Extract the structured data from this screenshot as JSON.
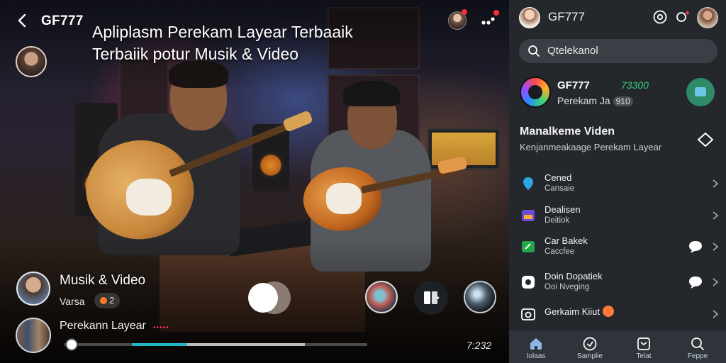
{
  "header": {
    "brand": "GF777",
    "headline_line1": "Apliplasm Perekam Layear Terbaaik",
    "headline_line2": "Terbaiik potur Musik & Video"
  },
  "author": {
    "name": "Musik & Video",
    "sub": "Varsa",
    "pill": "2"
  },
  "now_playing": {
    "title": "Perekann Layear",
    "indicator": "•••••"
  },
  "player": {
    "time": "7:232",
    "progress": 0.4
  },
  "panel": {
    "brand": "GF777",
    "search_placeholder": "Qtelekanol",
    "featured": {
      "title": "GF777",
      "price": "73300",
      "sub": "Perekam Ja",
      "chip": "910"
    },
    "section": {
      "title": "Manalkeme Viden",
      "sub": "Kenjanmeakaage Perekam Layear"
    },
    "menu": [
      {
        "title": "Cened",
        "sub": "Cansaie",
        "color": "#2aa6e0"
      },
      {
        "title": "Dealisen",
        "sub": "Deitiok",
        "color": "#6a4cd6"
      },
      {
        "title": "Car Bakek",
        "sub": "Caccfee",
        "color": "#22a84a"
      },
      {
        "title": "Doin Dopatiek",
        "sub": "Ooi Nveging",
        "color": "#ffffff"
      },
      {
        "title": "Gerkaim Kiiut",
        "sub": "",
        "color": "#ffffff"
      }
    ],
    "nav": [
      {
        "label": "Iolaas",
        "icon": "home-icon"
      },
      {
        "label": "Samplie",
        "icon": "compass-icon"
      },
      {
        "label": "Telat",
        "icon": "inbox-icon"
      },
      {
        "label": "Feppe",
        "icon": "search-icon"
      }
    ]
  },
  "colors": {
    "panel_bg": "#24272c",
    "accent_teal": "#22b7c6",
    "price_green": "#35d07a",
    "notif_red": "#ff2d3a"
  }
}
